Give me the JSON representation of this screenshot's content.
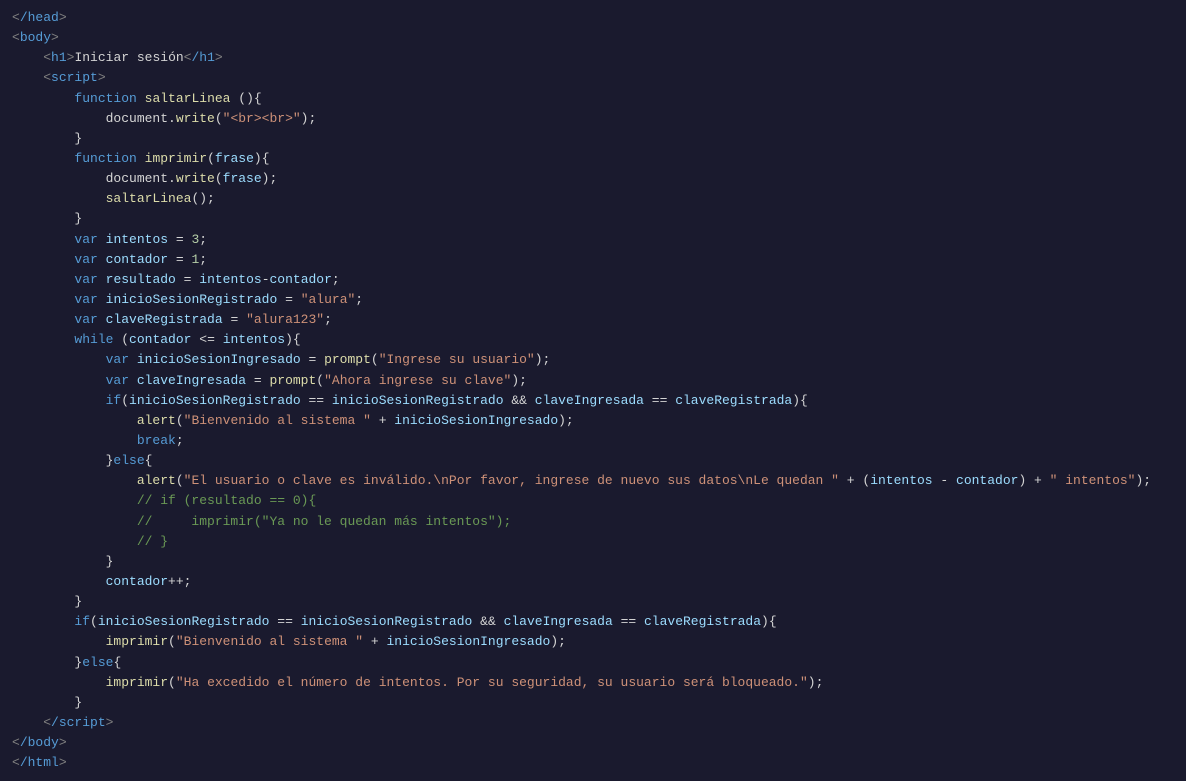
{
  "editor": {
    "lines": [
      {
        "id": 1,
        "content": "&lt;/head&gt;"
      },
      {
        "id": 2,
        "content": "&lt;body&gt;"
      },
      {
        "id": 3,
        "content": "    &lt;h1&gt;Iniciar sesión&lt;/h1&gt;"
      },
      {
        "id": 4,
        "content": "    &lt;script&gt;"
      },
      {
        "id": 5,
        "content": "        <span class='kw'>function</span> <span class='fn-name'>saltarLinea</span> (){"
      },
      {
        "id": 6,
        "content": "            document.<span class='method'>write</span>(<span class='str'>\"&lt;br&gt;&lt;br&gt;\"</span>);"
      },
      {
        "id": 7,
        "content": "        }"
      },
      {
        "id": 8,
        "content": "        <span class='kw'>function</span> <span class='fn-name'>imprimir</span>(<span class='param'>frase</span>){"
      },
      {
        "id": 9,
        "content": "            document.<span class='method'>write</span>(<span class='param'>frase</span>);"
      },
      {
        "id": 10,
        "content": "            <span class='fn-name'>saltarLinea</span>();"
      },
      {
        "id": 11,
        "content": "        }"
      },
      {
        "id": 12,
        "content": "        <span class='kw-var'>var</span> <span class='var-name'>intentos</span> = <span class='num'>3</span>;"
      },
      {
        "id": 13,
        "content": "        <span class='kw-var'>var</span> <span class='var-name'>contador</span> = <span class='num'>1</span>;"
      },
      {
        "id": 14,
        "content": "        <span class='kw-var'>var</span> <span class='var-name'>resultado</span> = <span class='var-name'>intentos</span>-<span class='var-name'>contador</span>;"
      },
      {
        "id": 15,
        "content": "        <span class='kw-var'>var</span> <span class='var-name'>inicioSesionRegistrado</span> = <span class='str'>\"alura\"</span>;"
      },
      {
        "id": 16,
        "content": "        <span class='kw-var'>var</span> <span class='var-name'>claveRegistrada</span> = <span class='str'>\"alura123\"</span>;"
      },
      {
        "id": 17,
        "content": "        <span class='kw'>while</span> (<span class='var-name'>contador</span> &lt;= <span class='var-name'>intentos</span>){"
      },
      {
        "id": 18,
        "content": "            <span class='kw-var'>var</span> <span class='var-name'>inicioSesionIngresado</span> = <span class='method'>prompt</span>(<span class='str'>\"Ingrese su usuario\"</span>);"
      },
      {
        "id": 19,
        "content": "            <span class='kw-var'>var</span> <span class='var-name'>claveIngresada</span> = <span class='method'>prompt</span>(<span class='str'>\"Ahora ingrese su clave\"</span>);"
      },
      {
        "id": 20,
        "content": "            <span class='kw'>if</span>(<span class='var-name'>inicioSesionRegistrado</span> == <span class='var-name'>inicioSesionRegistrado</span> &amp;&amp; <span class='var-name'>claveIngresada</span> == <span class='var-name'>claveRegistrada</span>){"
      },
      {
        "id": 21,
        "content": "                <span class='method'>alert</span>(<span class='str'>\"Bienvenido al sistema \"</span> + <span class='var-name'>inicioSesionIngresado</span>);"
      },
      {
        "id": 22,
        "content": "                <span class='kw'>break</span>;"
      },
      {
        "id": 23,
        "content": "            }<span class='kw'>else</span>{"
      },
      {
        "id": 24,
        "content": "                <span class='method'>alert</span>(<span class='str'>\"El usuario o clave es inválido.\\nPor favor, ingrese de nuevo sus datos\\nLe quedan \"</span> + (<span class='var-name'>intentos</span> - <span class='var-name'>contador</span>) + <span class='str'>\" intentos\"</span>);"
      },
      {
        "id": 25,
        "content": "                <span class='comment'>// if (resultado == 0){</span>"
      },
      {
        "id": 26,
        "content": "                <span class='comment'>//     imprimir(\"Ya no le quedan más intentos\");</span>"
      },
      {
        "id": 27,
        "content": "                <span class='comment'>// }</span>"
      },
      {
        "id": 28,
        "content": "            }"
      },
      {
        "id": 29,
        "content": "            <span class='var-name'>contador</span>++;"
      },
      {
        "id": 30,
        "content": "        }"
      },
      {
        "id": 31,
        "content": "        <span class='kw'>if</span>(<span class='var-name'>inicioSesionRegistrado</span> == <span class='var-name'>inicioSesionRegistrado</span> &amp;&amp; <span class='var-name'>claveIngresada</span> == <span class='var-name'>claveRegistrada</span>){"
      },
      {
        "id": 32,
        "content": "            <span class='fn-name'>imprimir</span>(<span class='str'>\"Bienvenido al sistema \"</span> + <span class='var-name'>inicioSesionIngresado</span>);"
      },
      {
        "id": 33,
        "content": "        }<span class='kw'>else</span>{"
      },
      {
        "id": 34,
        "content": "            <span class='fn-name'>imprimir</span>(<span class='str'>\"Ha excedido el número de intentos. Por su seguridad, su usuario será bloqueado.\"</span>);"
      },
      {
        "id": 35,
        "content": "        }"
      },
      {
        "id": 36,
        "content": "    &lt;/script&gt;"
      },
      {
        "id": 37,
        "content": "&lt;/body&gt;"
      },
      {
        "id": 38,
        "content": "&lt;/html&gt;"
      }
    ]
  }
}
